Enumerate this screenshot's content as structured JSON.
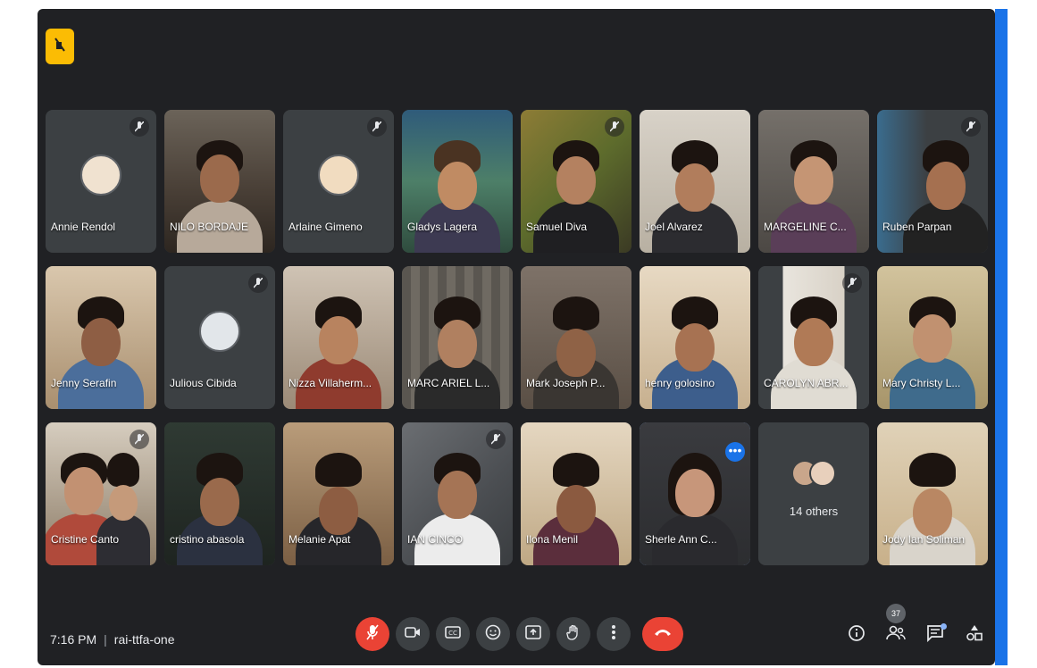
{
  "meeting": {
    "time": "7:16 PM",
    "code": "rai-ttfa-one"
  },
  "people_count": "37",
  "colors": {
    "window_bg": "#202124",
    "tile_bg": "#3c4043",
    "accent_blue": "#1a73e8",
    "host_badge": "#fbbc04",
    "end_call_red": "#ea4335"
  },
  "participants": [
    {
      "name": "Annie Rendol",
      "video": false,
      "muted": true
    },
    {
      "name": "NILO BORDAJE",
      "video": true,
      "muted": false
    },
    {
      "name": "Arlaine Gimeno",
      "video": false,
      "muted": true
    },
    {
      "name": "Gladys Lagera",
      "video": true,
      "muted": false
    },
    {
      "name": "Samuel Diva",
      "video": true,
      "muted": true
    },
    {
      "name": "Joel Alvarez",
      "video": true,
      "muted": false
    },
    {
      "name": "MARGELINE C...",
      "video": true,
      "muted": false
    },
    {
      "name": "Ruben Parpan",
      "video": true,
      "muted": true
    },
    {
      "name": "Jenny Serafin",
      "video": true,
      "muted": false
    },
    {
      "name": "Julious Cibida",
      "video": false,
      "muted": true
    },
    {
      "name": "Nizza Villaherm...",
      "video": true,
      "muted": false
    },
    {
      "name": "MARC ARIEL L...",
      "video": true,
      "muted": false
    },
    {
      "name": "Mark Joseph P...",
      "video": true,
      "muted": false
    },
    {
      "name": "henry golosino",
      "video": true,
      "muted": false
    },
    {
      "name": "CAROLYN ABR...",
      "video": true,
      "muted": true
    },
    {
      "name": "Mary Christy L...",
      "video": true,
      "muted": false
    },
    {
      "name": "Cristine Canto",
      "video": true,
      "muted": true
    },
    {
      "name": "cristino abasola",
      "video": true,
      "muted": false
    },
    {
      "name": "Melanie Apat",
      "video": true,
      "muted": false
    },
    {
      "name": "IAN CINCO",
      "video": true,
      "muted": true
    },
    {
      "name": "Ilona Menil",
      "video": true,
      "muted": false
    },
    {
      "name": "Sherle Ann C...",
      "video": true,
      "muted": false
    },
    {
      "name": "14 others",
      "video": false,
      "muted": false
    },
    {
      "name": "Jody Ian Soliman",
      "video": true,
      "muted": false
    }
  ],
  "icons": {
    "host": "hand-raise-icon",
    "mic": "mic-off-icon",
    "camera": "camera-icon",
    "captions": "captions-icon",
    "emoji": "emoji-icon",
    "present": "present-screen-icon",
    "raise_hand": "hand-icon",
    "more": "more-vert-icon",
    "leave": "call-end-icon",
    "info": "info-icon",
    "people": "people-icon",
    "chat": "chat-icon",
    "activities": "activities-icon"
  }
}
